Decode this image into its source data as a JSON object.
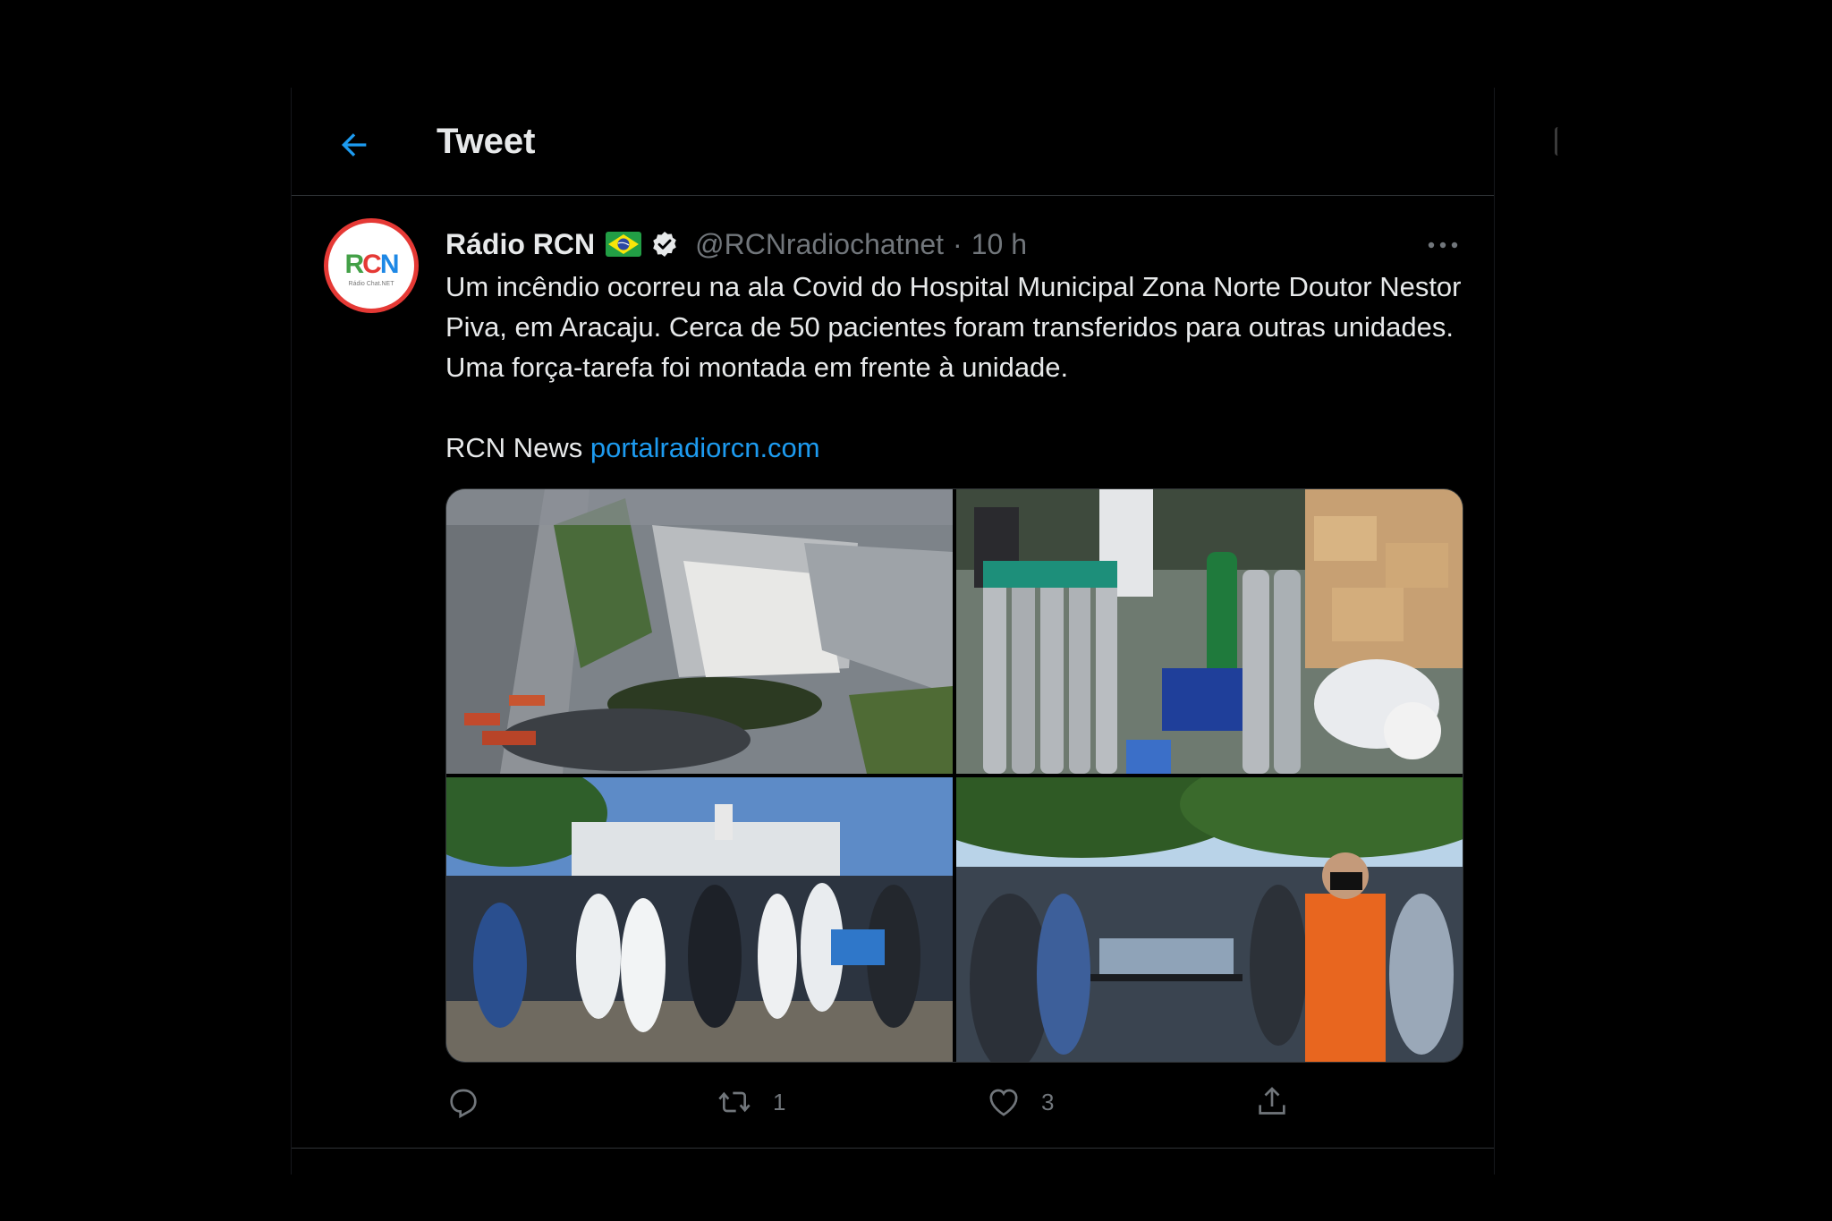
{
  "header": {
    "title": "Tweet",
    "back_icon": "arrow-left-icon"
  },
  "tweet": {
    "author": {
      "display_name": "Rádio RCN",
      "handle": "@RCNradiochatnet",
      "avatar_text": "RCN",
      "avatar_subtext": "Rádio Chat.NET",
      "flag": "brazil-flag-icon",
      "verified": true
    },
    "time": "10 h",
    "separator": "·",
    "text_paragraph": "Um incêndio ocorreu na ala Covid do Hospital Municipal Zona Norte Doutor Nestor Piva, em Aracaju. Cerca de 50 pacientes foram transferidos para outras unidades. Uma força-tarefa foi montada em frente à unidade.",
    "footer_prefix": "RCN News ",
    "link_text": "portalradiorcn.com",
    "media": [
      {
        "name": "photo-aerial-hospital"
      },
      {
        "name": "photo-oxygen-cylinders"
      },
      {
        "name": "photo-medical-staff-crowd"
      },
      {
        "name": "photo-patient-transfer"
      }
    ],
    "actions": {
      "reply": {
        "icon": "reply-icon",
        "count": ""
      },
      "retweet": {
        "icon": "retweet-icon",
        "count": "1"
      },
      "like": {
        "icon": "heart-icon",
        "count": "3"
      },
      "share": {
        "icon": "share-icon"
      }
    }
  },
  "colors": {
    "background": "#000000",
    "text_primary": "#e7e9ea",
    "text_secondary": "#71767b",
    "accent": "#1d9bf0",
    "border": "#2f3336"
  }
}
